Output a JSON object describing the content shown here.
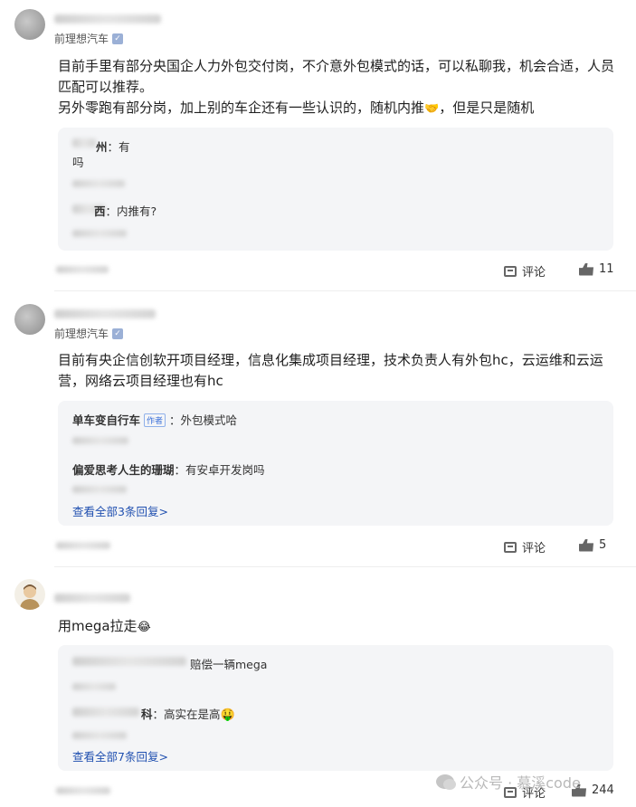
{
  "comments": [
    {
      "tag": "前理想汽车",
      "text": [
        "目前手里有部分央国企人力外包交付岗，不介意外包模式的话，可以私聊我，机会合适，人员匹配可以推荐。",
        "另外零跑有部分岗，加上别的车企还有一些认识的，随机内推",
        "，但是只是随机"
      ],
      "replies": [
        {
          "who": "州",
          "text": "：有"
        },
        {
          "who": "",
          "text": "吗"
        },
        {
          "who": "西",
          "text": "：内推有?"
        }
      ],
      "actions": {
        "comment_label": "评论",
        "likes": "11"
      }
    },
    {
      "tag": "前理想汽车",
      "text": [
        "目前有央企信创软开项目经理，信息化集成项目经理，技术负责人有外包hc，云运维和云运营，网络云项目经理也有hc"
      ],
      "replies": [
        {
          "who": "单车变自行车",
          "badge": "作者",
          "text": "：外包模式哈"
        },
        {
          "who": "偏爱思考人生的珊瑚",
          "text": "：有安卓开发岗吗"
        }
      ],
      "view_all": "查看全部3条回复>",
      "actions": {
        "comment_label": "评论",
        "likes": "5"
      }
    },
    {
      "text": [
        "用mega拉走"
      ],
      "replies": [
        {
          "who": "",
          "text": "赔偿一辆mega"
        },
        {
          "who": "科",
          "text": "：高实在是高"
        }
      ],
      "view_all": "查看全部7条回复>",
      "actions": {
        "comment_label": "评论",
        "likes": "244"
      }
    }
  ],
  "watermark": {
    "text": "公众号 · 慕溪code"
  },
  "icons": {
    "verified": "verified-badge-icon",
    "comment": "comment-icon",
    "like": "thumbs-up-icon",
    "wechat": "wechat-icon"
  }
}
